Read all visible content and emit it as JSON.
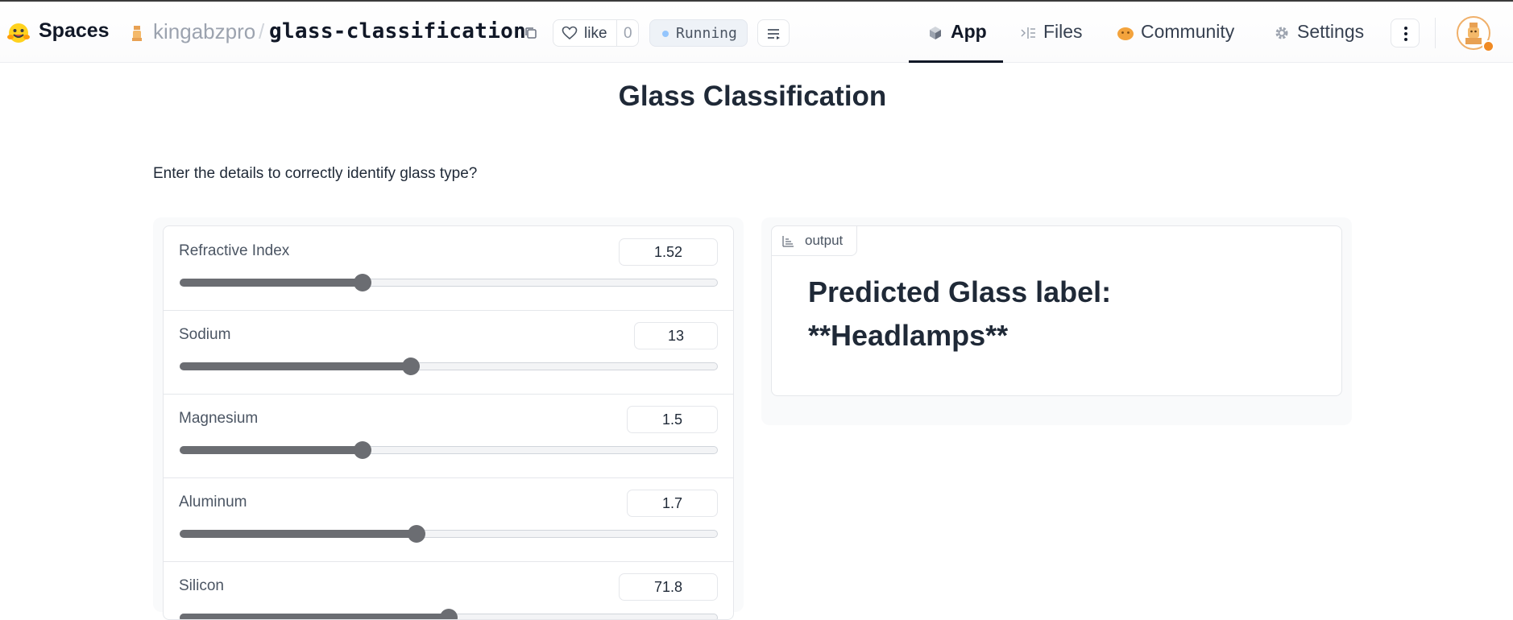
{
  "header": {
    "brand": "Spaces",
    "owner": "kingabzpro",
    "separator": "/",
    "repo": "glass-classification",
    "like_label": "like",
    "like_count": "0",
    "status": "Running",
    "tabs": [
      {
        "label": "App",
        "icon": "cube-icon",
        "active": true
      },
      {
        "label": "Files",
        "icon": "files-icon",
        "active": false
      },
      {
        "label": "Community",
        "icon": "community-icon",
        "active": false
      },
      {
        "label": "Settings",
        "icon": "gear-icon",
        "active": false
      }
    ]
  },
  "main": {
    "title": "Glass Classification",
    "description": "Enter the details to correctly identify glass type?",
    "sliders": [
      {
        "label": "Refractive Index",
        "value": "1.52",
        "fraction": 0.34
      },
      {
        "label": "Sodium",
        "value": "13",
        "fraction": 0.43
      },
      {
        "label": "Magnesium",
        "value": "1.5",
        "fraction": 0.34
      },
      {
        "label": "Aluminum",
        "value": "1.7",
        "fraction": 0.44
      },
      {
        "label": "Silicon",
        "value": "71.8",
        "fraction": 0.5
      }
    ],
    "output": {
      "tag": "output",
      "line1": "Predicted Glass label:",
      "line2": "**Headlamps**"
    }
  },
  "colors": {
    "accent": "#111827",
    "slider": "#6b6d72",
    "running_dot": "#93c5fd",
    "avatar_ring": "#f0b06a"
  }
}
